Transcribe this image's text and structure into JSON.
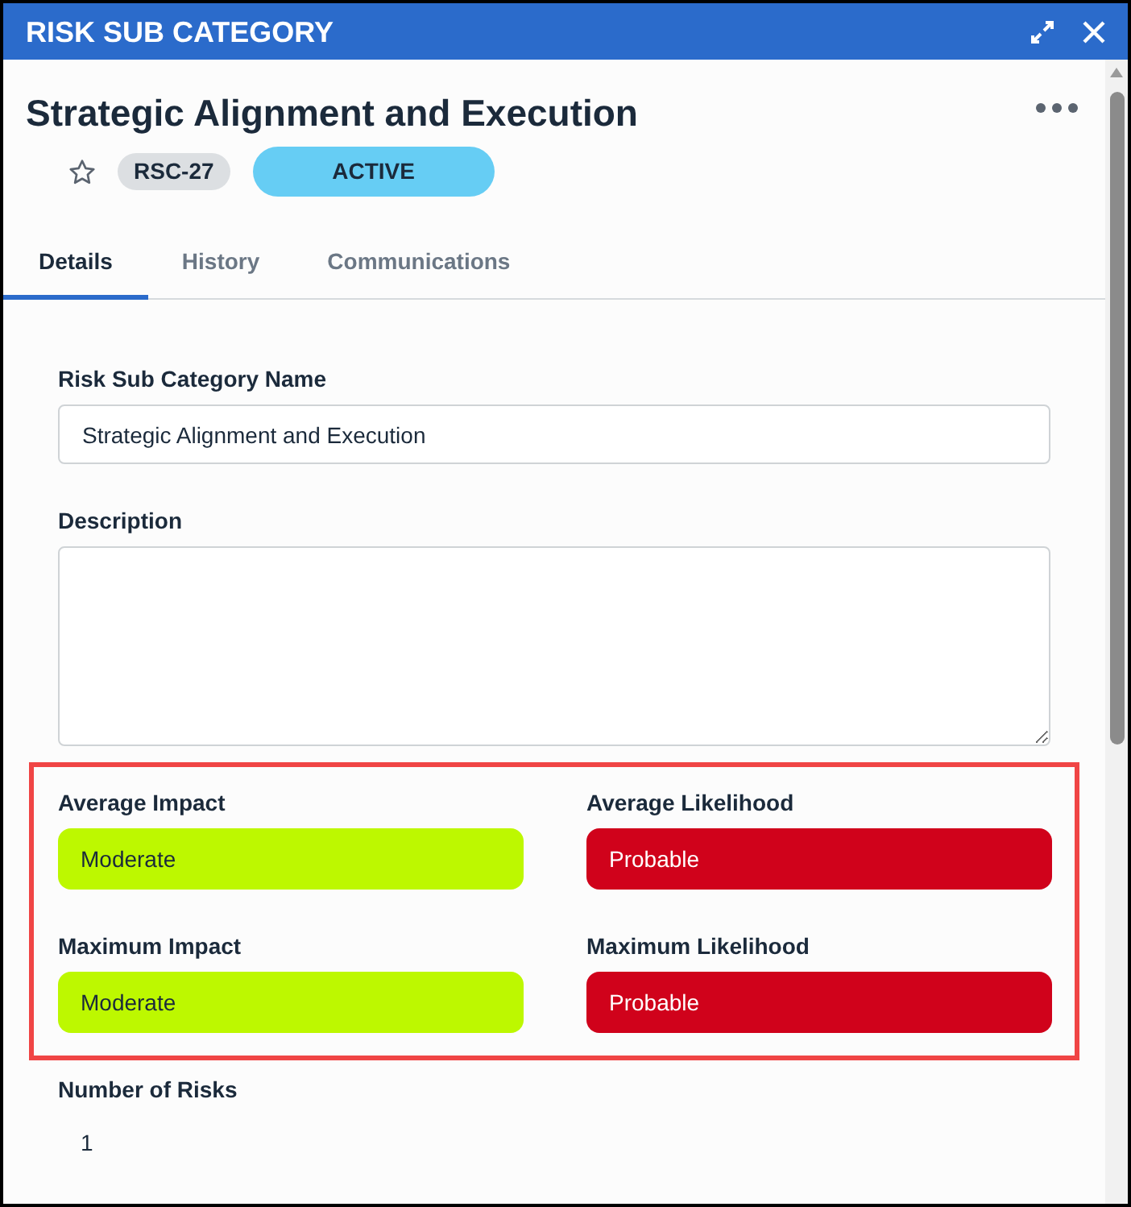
{
  "window": {
    "title": "RISK SUB CATEGORY"
  },
  "record": {
    "title": "Strategic Alignment and Execution",
    "favorite": false,
    "id": "RSC-27",
    "status": "ACTIVE"
  },
  "tabs": [
    {
      "label": "Details",
      "selected": true
    },
    {
      "label": "History",
      "selected": false
    },
    {
      "label": "Communications",
      "selected": false
    }
  ],
  "fields": [
    {
      "kind": "text",
      "label": "Risk Sub Category Name",
      "value": "Strategic Alignment and Execution"
    },
    {
      "kind": "textarea",
      "label": "Description"
    }
  ],
  "risk_levels": {
    "highlighted": true,
    "items": [
      {
        "label": "Average Impact",
        "value": "Moderate",
        "color": "#bdf800"
      },
      {
        "label": "Average Likelihood",
        "value": "Probable",
        "color": "#d0021b"
      },
      {
        "label": "Maximum Impact",
        "value": "Moderate",
        "color": "#bdf800"
      },
      {
        "label": "Maximum Likelihood",
        "value": "Probable",
        "color": "#d0021b"
      }
    ]
  },
  "number_of_risks": {
    "label": "Number of Risks",
    "value": "1"
  }
}
